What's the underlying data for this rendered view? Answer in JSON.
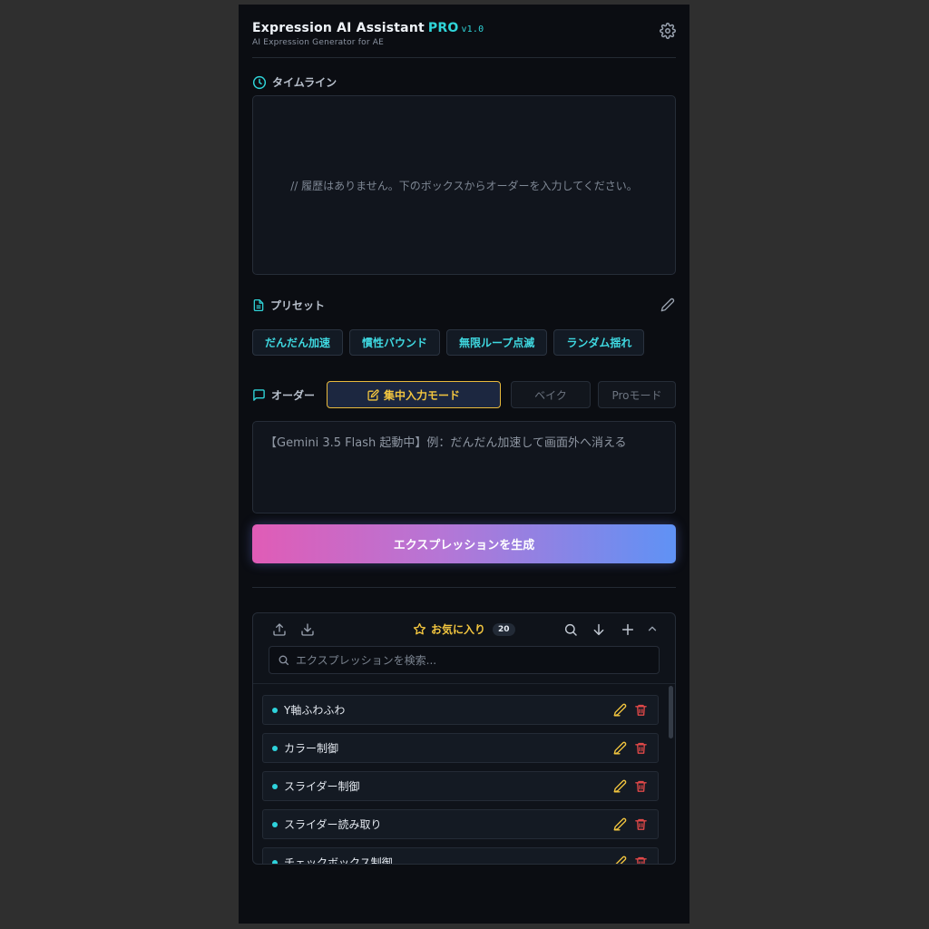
{
  "header": {
    "title": "Expression AI Assistant",
    "pro": "PRO",
    "version": "v1.0",
    "subtitle": "AI Expression Generator for AE"
  },
  "timeline": {
    "label": "タイムライン",
    "empty_text": "//  履歴はありません。下のボックスからオーダーを入力してください。"
  },
  "presets": {
    "label": "プリセット",
    "items": [
      "だんだん加速",
      "慣性バウンド",
      "無限ループ点滅",
      "ランダム揺れ"
    ]
  },
  "order": {
    "label": "オーダー",
    "focus_mode": "集中入力モード",
    "bake": "ベイク",
    "pro_mode": "Proモード",
    "placeholder": "【Gemini 3.5 Flash 起動中】例：だんだん加速して画面外へ消える"
  },
  "generate_button": "エクスプレッションを生成",
  "favorites": {
    "title": "お気に入り",
    "count": "20",
    "search_placeholder": "エクスプレッションを検索...",
    "items": [
      "Y軸ふわふわ",
      "カラー制御",
      "スライダー制御",
      "スライダー読み取り",
      "チェックボックス制御"
    ]
  },
  "colors": {
    "accent_cyan": "#2fd4d8",
    "accent_yellow": "#f2c53f",
    "delete_red": "#e04848",
    "gradient_start": "#e05cb6",
    "gradient_end": "#5f92f5"
  }
}
